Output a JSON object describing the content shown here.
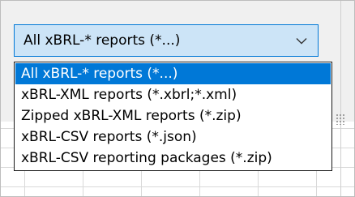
{
  "combo": {
    "value": "All xBRL-* reports (*...)",
    "arrow_icon": "chevron-down-icon"
  },
  "dropdown": {
    "options": [
      {
        "label": "All xBRL-* reports (*...)",
        "selected": true
      },
      {
        "label": "xBRL-XML reports (*.xbrl;*.xml)",
        "selected": false
      },
      {
        "label": "Zipped xBRL-XML reports (*.zip)",
        "selected": false
      },
      {
        "label": "xBRL-CSV reports (*.json)",
        "selected": false
      },
      {
        "label": "xBRL-CSV reporting packages (*.zip)",
        "selected": false
      }
    ]
  },
  "colors": {
    "accent": "#0078d7",
    "combo_background": "#cce4f7",
    "selected_text": "#ffffff"
  }
}
